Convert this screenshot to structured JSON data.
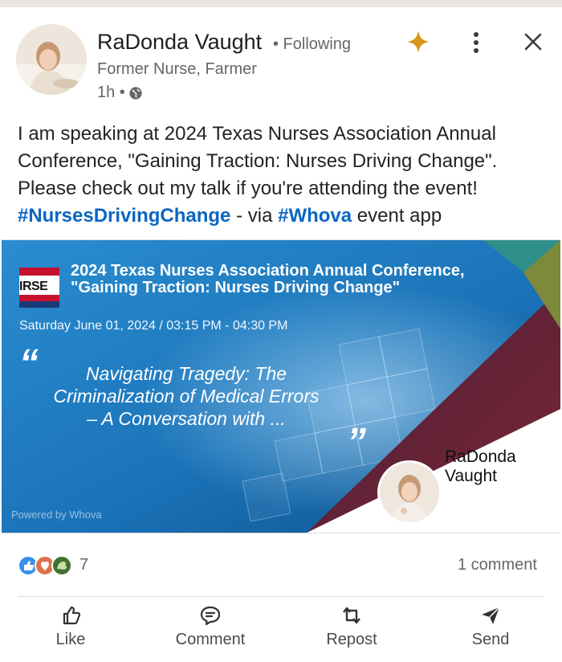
{
  "post": {
    "author_name": "RaDonda Vaught",
    "following_label": "• Following",
    "subtitle": "Former Nurse, Farmer",
    "time": "1h •",
    "text_line1": "I am speaking at 2024 Texas Nurses Association Annual",
    "text_line2": "Conference, \"Gaining Traction: Nurses Driving Change\".",
    "text_line3": "Please check out my talk if you're attending the event!",
    "hashtag1": "#NursesDrivingChange",
    "via_text": " - via ",
    "hashtag2": "#Whova",
    "tail_text": " event app"
  },
  "banner": {
    "logo_text": "IRSE",
    "conference_title": "2024 Texas Nurses Association Annual Conference, \"Gaining Traction: Nurses Driving Change\"",
    "session_time": "Saturday June 01, 2024 / 03:15 PM - 04:30 PM",
    "quote_open": "“",
    "quote_close": "”",
    "talk_title": "Navigating Tragedy: The Criminalization of Medical Errors – A Conversation with ...",
    "speaker_first": "RaDonda",
    "speaker_last": "Vaught",
    "powered_by": "Powered by Whova"
  },
  "social": {
    "reaction_count": "7",
    "comment_count": "1 comment"
  },
  "actions": {
    "like": "Like",
    "comment": "Comment",
    "repost": "Repost",
    "send": "Send"
  },
  "colors": {
    "link_blue": "#0a66c2",
    "spark_gold": "#d9951a",
    "banner_blue": "#1f7fc4",
    "banner_maroon": "#6b2234"
  }
}
